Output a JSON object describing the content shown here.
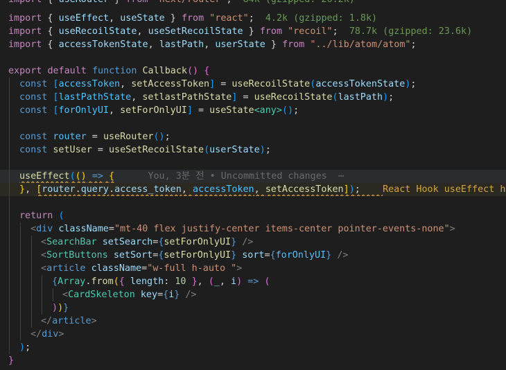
{
  "editor": {
    "lines": [
      [
        [
          "kw",
          "import"
        ],
        [
          "p",
          " { "
        ],
        [
          "var",
          "useRouter"
        ],
        [
          "p",
          " } "
        ],
        [
          "kw",
          "from"
        ],
        [
          "p",
          " "
        ],
        [
          "str",
          "\"next/router\""
        ],
        [
          "p",
          ";  "
        ],
        [
          "size",
          "84k (gzipped: 26.2k)"
        ]
      ],
      [
        [
          "kw",
          "import"
        ],
        [
          "p",
          " { "
        ],
        [
          "var",
          "useEffect"
        ],
        [
          "p",
          ", "
        ],
        [
          "var",
          "useState"
        ],
        [
          "p",
          " } "
        ],
        [
          "kw",
          "from"
        ],
        [
          "p",
          " "
        ],
        [
          "str",
          "\"react\""
        ],
        [
          "p",
          ";  "
        ],
        [
          "size",
          "4.2k (gzipped: 1.8k)"
        ]
      ],
      [
        [
          "kw",
          "import"
        ],
        [
          "p",
          " { "
        ],
        [
          "var",
          "useRecoilState"
        ],
        [
          "p",
          ", "
        ],
        [
          "var",
          "useSetRecoilState"
        ],
        [
          "p",
          " } "
        ],
        [
          "kw",
          "from"
        ],
        [
          "p",
          " "
        ],
        [
          "str",
          "\"recoil\""
        ],
        [
          "p",
          ";  "
        ],
        [
          "size",
          "78.7k (gzipped: 23.6k)"
        ]
      ],
      [
        [
          "kw",
          "import"
        ],
        [
          "p",
          " { "
        ],
        [
          "var",
          "accessTokenState"
        ],
        [
          "p",
          ", "
        ],
        [
          "var",
          "lastPath"
        ],
        [
          "p",
          ", "
        ],
        [
          "var",
          "userState"
        ],
        [
          "p",
          " } "
        ],
        [
          "kw",
          "from"
        ],
        [
          "p",
          " "
        ],
        [
          "str",
          "\"../lib/atom/atom\""
        ],
        [
          "p",
          ";"
        ]
      ],
      [],
      [
        [
          "kw",
          "export"
        ],
        [
          "p",
          " "
        ],
        [
          "kw",
          "default"
        ],
        [
          "p",
          " "
        ],
        [
          "decl",
          "function"
        ],
        [
          "p",
          " "
        ],
        [
          "fn",
          "Callback"
        ],
        [
          "br2",
          "()"
        ],
        [
          "p",
          " "
        ],
        [
          "br2",
          "{"
        ]
      ],
      [
        [
          "decl",
          "const"
        ],
        [
          "p",
          " "
        ],
        [
          "br3",
          "["
        ],
        [
          "const",
          "accessToken"
        ],
        [
          "p",
          ", "
        ],
        [
          "fn",
          "setAccessToken"
        ],
        [
          "br3",
          "]"
        ],
        [
          "p",
          " = "
        ],
        [
          "fn",
          "useRecoilState"
        ],
        [
          "br3",
          "("
        ],
        [
          "var",
          "accessTokenState"
        ],
        [
          "br3",
          ")"
        ],
        [
          "p",
          ";"
        ]
      ],
      [
        [
          "decl",
          "const"
        ],
        [
          "p",
          " "
        ],
        [
          "br3",
          "["
        ],
        [
          "const",
          "lastPathState"
        ],
        [
          "p",
          ", "
        ],
        [
          "fn",
          "setlastPathState"
        ],
        [
          "br3",
          "]"
        ],
        [
          "p",
          " = "
        ],
        [
          "fn",
          "useRecoilState"
        ],
        [
          "br3",
          "("
        ],
        [
          "var",
          "lastPath"
        ],
        [
          "br3",
          ")"
        ],
        [
          "p",
          ";"
        ]
      ],
      [
        [
          "decl",
          "const"
        ],
        [
          "p",
          " "
        ],
        [
          "br3",
          "["
        ],
        [
          "const",
          "forOnlyUI"
        ],
        [
          "p",
          ", "
        ],
        [
          "fn",
          "setForOnlyUI"
        ],
        [
          "br3",
          "]"
        ],
        [
          "p",
          " = "
        ],
        [
          "fn",
          "useState"
        ],
        [
          "tag",
          "<any>"
        ],
        [
          "br3",
          "()"
        ],
        [
          "p",
          ";"
        ]
      ],
      [],
      [
        [
          "decl",
          "const"
        ],
        [
          "p",
          " "
        ],
        [
          "const",
          "router"
        ],
        [
          "p",
          " = "
        ],
        [
          "fn",
          "useRouter"
        ],
        [
          "br3",
          "()"
        ],
        [
          "p",
          ";"
        ]
      ],
      [
        [
          "decl",
          "const"
        ],
        [
          "p",
          " "
        ],
        [
          "fn",
          "setUser"
        ],
        [
          "p",
          " = "
        ],
        [
          "fn",
          "useSetRecoilState"
        ],
        [
          "br3",
          "("
        ],
        [
          "var",
          "userState"
        ],
        [
          "br3",
          ")"
        ],
        [
          "p",
          ";"
        ]
      ],
      [],
      [
        [
          "fn",
          "useEffect"
        ],
        [
          "br3",
          "("
        ],
        [
          "br1",
          "()"
        ],
        [
          "p",
          " "
        ],
        [
          "decl",
          "=>"
        ],
        [
          "p",
          " "
        ],
        [
          "br1",
          "{"
        ],
        [
          "p",
          "      "
        ],
        [
          "blame",
          "You, 3분 전 • Uncommitted changes  ⋯"
        ]
      ],
      [
        [
          "br1",
          "}"
        ],
        [
          "p",
          ", "
        ],
        [
          "br1",
          "["
        ],
        [
          "var",
          "router"
        ],
        [
          "p",
          "."
        ],
        [
          "var",
          "query"
        ],
        [
          "p",
          "."
        ],
        [
          "var",
          "access_token"
        ],
        [
          "p",
          ", "
        ],
        [
          "const",
          "accessToken"
        ],
        [
          "p",
          ", "
        ],
        [
          "fn",
          "setAccessToken"
        ],
        [
          "br1",
          "]"
        ],
        [
          "br3",
          ")"
        ],
        [
          "p",
          ";    "
        ],
        [
          "diag",
          "React Hook useEffect has m"
        ]
      ],
      [],
      [
        [
          "kw",
          "return"
        ],
        [
          "p",
          " "
        ],
        [
          "br3",
          "("
        ]
      ],
      [
        [
          "tagp",
          "<"
        ],
        [
          "decl",
          "div"
        ],
        [
          "p",
          " "
        ],
        [
          "var",
          "className"
        ],
        [
          "p",
          "="
        ],
        [
          "str",
          "\"mt-40 flex justify-center items-center pointer-events-none\""
        ],
        [
          "tagp",
          ">"
        ]
      ],
      [
        [
          "tagp",
          "<"
        ],
        [
          "tag",
          "SearchBar"
        ],
        [
          "p",
          " "
        ],
        [
          "var",
          "setSearch"
        ],
        [
          "p",
          "="
        ],
        [
          "decl",
          "{"
        ],
        [
          "fn",
          "setForOnlyUI"
        ],
        [
          "decl",
          "}"
        ],
        [
          "p",
          " "
        ],
        [
          "tagp",
          "/>"
        ]
      ],
      [
        [
          "tagp",
          "<"
        ],
        [
          "tag",
          "SortButtons"
        ],
        [
          "p",
          " "
        ],
        [
          "var",
          "setSort"
        ],
        [
          "p",
          "="
        ],
        [
          "decl",
          "{"
        ],
        [
          "fn",
          "setForOnlyUI"
        ],
        [
          "decl",
          "}"
        ],
        [
          "p",
          " "
        ],
        [
          "var",
          "sort"
        ],
        [
          "p",
          "="
        ],
        [
          "decl",
          "{"
        ],
        [
          "const",
          "forOnlyUI"
        ],
        [
          "decl",
          "}"
        ],
        [
          "p",
          " "
        ],
        [
          "tagp",
          "/>"
        ]
      ],
      [
        [
          "tagp",
          "<"
        ],
        [
          "decl",
          "article"
        ],
        [
          "p",
          " "
        ],
        [
          "var",
          "className"
        ],
        [
          "p",
          "="
        ],
        [
          "str",
          "\"w-full h-auto \""
        ],
        [
          "tagp",
          ">"
        ]
      ],
      [
        [
          "decl",
          "{"
        ],
        [
          "tag",
          "Array"
        ],
        [
          "p",
          "."
        ],
        [
          "fn",
          "from"
        ],
        [
          "br1",
          "("
        ],
        [
          "br2",
          "{"
        ],
        [
          "p",
          " "
        ],
        [
          "var",
          "length"
        ],
        [
          "p",
          ": "
        ],
        [
          "num",
          "10"
        ],
        [
          "p",
          " "
        ],
        [
          "br2",
          "}"
        ],
        [
          "p",
          ", "
        ],
        [
          "br2",
          "("
        ],
        [
          "var",
          "_"
        ],
        [
          "p",
          ", "
        ],
        [
          "var",
          "i"
        ],
        [
          "br2",
          ")"
        ],
        [
          "p",
          " "
        ],
        [
          "decl",
          "=>"
        ],
        [
          "p",
          " "
        ],
        [
          "br2",
          "("
        ]
      ],
      [
        [
          "tagp",
          "<"
        ],
        [
          "tag",
          "CardSkeleton"
        ],
        [
          "p",
          " "
        ],
        [
          "var",
          "key"
        ],
        [
          "p",
          "="
        ],
        [
          "decl",
          "{"
        ],
        [
          "var",
          "i"
        ],
        [
          "decl",
          "}"
        ],
        [
          "p",
          " "
        ],
        [
          "tagp",
          "/>"
        ]
      ],
      [
        [
          "br2",
          ")"
        ],
        [
          "br1",
          ")"
        ],
        [
          "decl",
          "}"
        ]
      ],
      [
        [
          "tagp",
          "</"
        ],
        [
          "decl",
          "article"
        ],
        [
          "tagp",
          ">"
        ]
      ],
      [
        [
          "tagp",
          "</"
        ],
        [
          "decl",
          "div"
        ],
        [
          "tagp",
          ">"
        ]
      ],
      [
        [
          "br3",
          ")"
        ],
        [
          "p",
          ";"
        ]
      ],
      [
        [
          "br2",
          "}"
        ]
      ]
    ]
  }
}
